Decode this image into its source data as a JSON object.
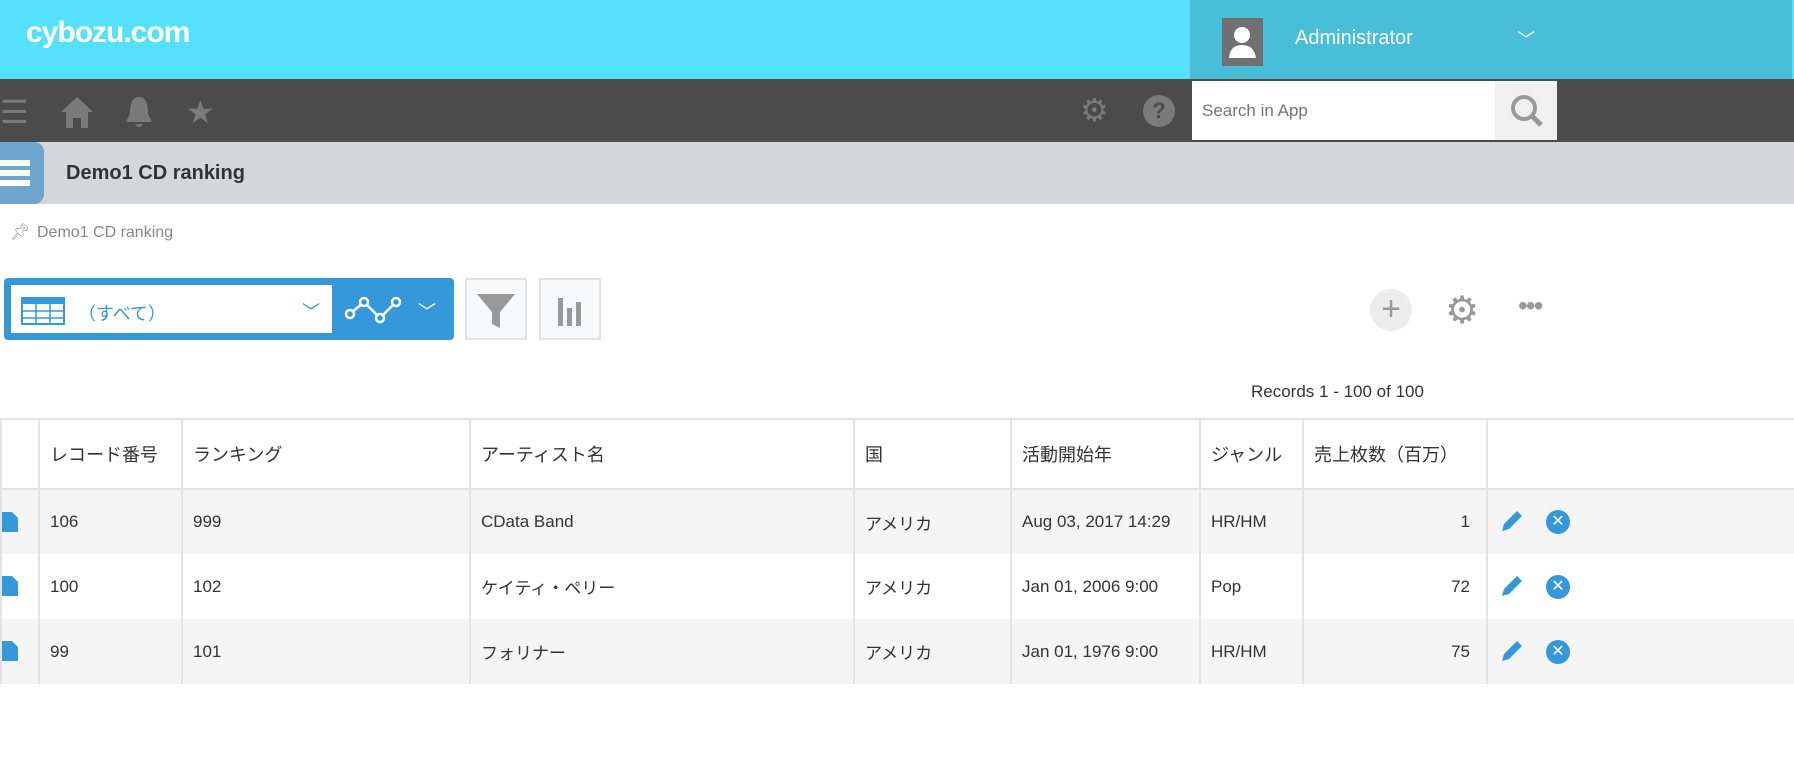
{
  "header": {
    "logo": "cybozu.com",
    "user": "Administrator",
    "search_placeholder": "Search in App"
  },
  "app": {
    "title": "Demo1 CD ranking",
    "breadcrumb": "Demo1 CD ranking"
  },
  "toolbar": {
    "view": "（すべて）",
    "records": "Records 1 - 100 of 100"
  },
  "colors": {
    "top": "#55e0fb",
    "accent": "#3498db",
    "nav": "#4b4b4b"
  },
  "table": {
    "columns": [
      "レコード番号",
      "ランキング",
      "アーティスト名",
      "国",
      "活動開始年",
      "ジャンル",
      "売上枚数（百万）"
    ],
    "rows": [
      [
        "106",
        "999",
        "CData Band",
        "アメリカ",
        "Aug 03, 2017 14:29",
        "HR/HM",
        "1"
      ],
      [
        "100",
        "102",
        "ケイティ・ペリー",
        "アメリカ",
        "Jan 01, 2006 9:00",
        "Pop",
        "72"
      ],
      [
        "99",
        "101",
        "フォリナー",
        "アメリカ",
        "Jan 01, 1976 9:00",
        "HR/HM",
        "75"
      ]
    ]
  }
}
